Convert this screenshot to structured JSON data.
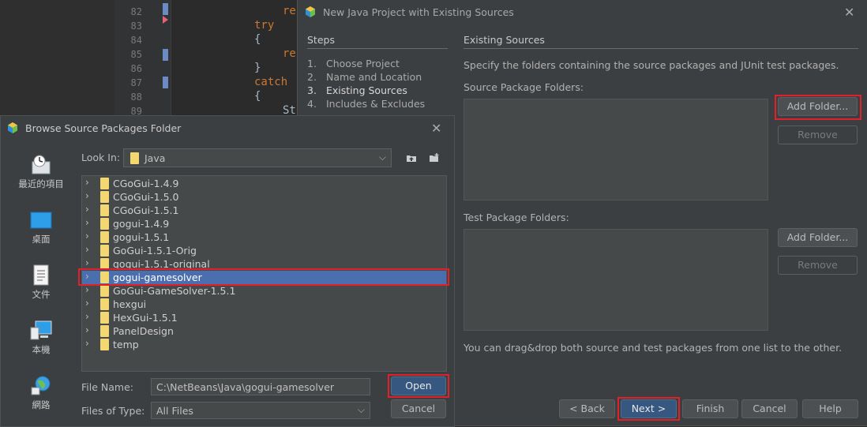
{
  "editor": {
    "line_numbers": [
      "82",
      "83",
      "84",
      "85",
      "86",
      "87",
      "88",
      "89"
    ],
    "code_lines": [
      "re",
      "try",
      "{",
      "re",
      "}",
      "catch",
      "{",
      "St"
    ]
  },
  "wizard": {
    "title": "New Java Project with Existing Sources",
    "steps_title": "Steps",
    "steps": [
      {
        "num": "1.",
        "label": "Choose Project"
      },
      {
        "num": "2.",
        "label": "Name and Location"
      },
      {
        "num": "3.",
        "label": "Existing Sources"
      },
      {
        "num": "4.",
        "label": "Includes & Excludes"
      }
    ],
    "section_title": "Existing Sources",
    "description": "Specify the folders containing the source packages and JUnit test packages.",
    "source_label": "Source Package Folders:",
    "test_label": "Test Package Folders:",
    "add_folder": "Add Folder...",
    "remove": "Remove",
    "footer_text": "You can drag&drop both source and test packages from one list to the other.",
    "buttons": {
      "back": "< Back",
      "next": "Next >",
      "finish": "Finish",
      "cancel": "Cancel",
      "help": "Help"
    }
  },
  "browse": {
    "title": "Browse Source Packages Folder",
    "places": [
      "最近的項目",
      "桌面",
      "文件",
      "本機",
      "網路"
    ],
    "look_in_label": "Look In:",
    "look_in_value": "Java",
    "folders": [
      "CGoGui-1.4.9",
      "CGoGui-1.5.0",
      "CGoGui-1.5.1",
      "gogui-1.4.9",
      "gogui-1.5.1",
      "GoGui-1.5.1-Orig",
      "gogui-1.5.1-original",
      "gogui-gamesolver",
      "GoGui-GameSolver-1.5.1",
      "hexgui",
      "HexGui-1.5.1",
      "PanelDesign",
      "temp"
    ],
    "selected_folder": "gogui-gamesolver",
    "file_name_label": "File Name:",
    "file_name_value": "C:\\NetBeans\\Java\\gogui-gamesolver",
    "files_of_type_label": "Files of Type:",
    "files_of_type_value": "All Files",
    "open": "Open",
    "cancel": "Cancel"
  },
  "colors": {
    "accent": "#365880",
    "selection": "#4b6eaf",
    "highlight_box": "#e3202a",
    "folder": "#f3d872"
  }
}
